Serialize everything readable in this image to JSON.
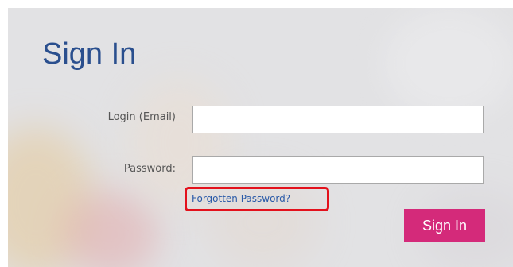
{
  "signin": {
    "title": "Sign In",
    "email_label": "Login (Email)",
    "email_value": "",
    "password_label": "Password:",
    "password_value": "",
    "forgot_link": "Forgotten Password?",
    "submit_label": "Sign In"
  },
  "colors": {
    "title": "#2a4f8e",
    "link": "#2a5aa8",
    "highlight_border": "#e3111c",
    "submit_bg": "#d42a7a",
    "submit_text": "#ffffff"
  }
}
